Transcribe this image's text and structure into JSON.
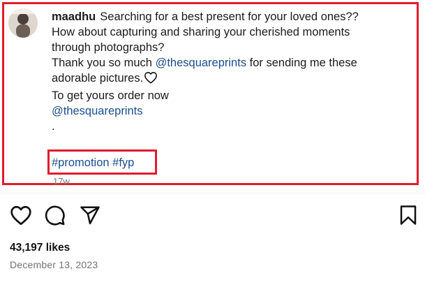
{
  "post": {
    "username": "maadhu",
    "caption_lines": {
      "l1": "Searching for a best present for your loved ones??",
      "l2": "How about capturing and sharing your cherished moments",
      "l3": "through photographs?",
      "l4_a": "Thank you so much ",
      "l4_mention": "@thesquareprints",
      "l4_b": " for sending me these",
      "l5": "adorable pictures.",
      "l6": "To get yours order now",
      "l7_mention": "@thesquareprints",
      "l8": "."
    },
    "hashtags": {
      "tag1": "#promotion",
      "tag2": "#fyp"
    },
    "time_ago": "17w"
  },
  "engagement": {
    "likes": "43,197 likes",
    "date": "December 13, 2023"
  },
  "icons": {
    "like": "heart-outline-icon",
    "comment": "comment-bubble-icon",
    "share": "paper-plane-icon",
    "save": "bookmark-icon"
  },
  "colors": {
    "highlight": "#e21b2d",
    "link": "#1a4e8f",
    "muted": "#737373"
  }
}
